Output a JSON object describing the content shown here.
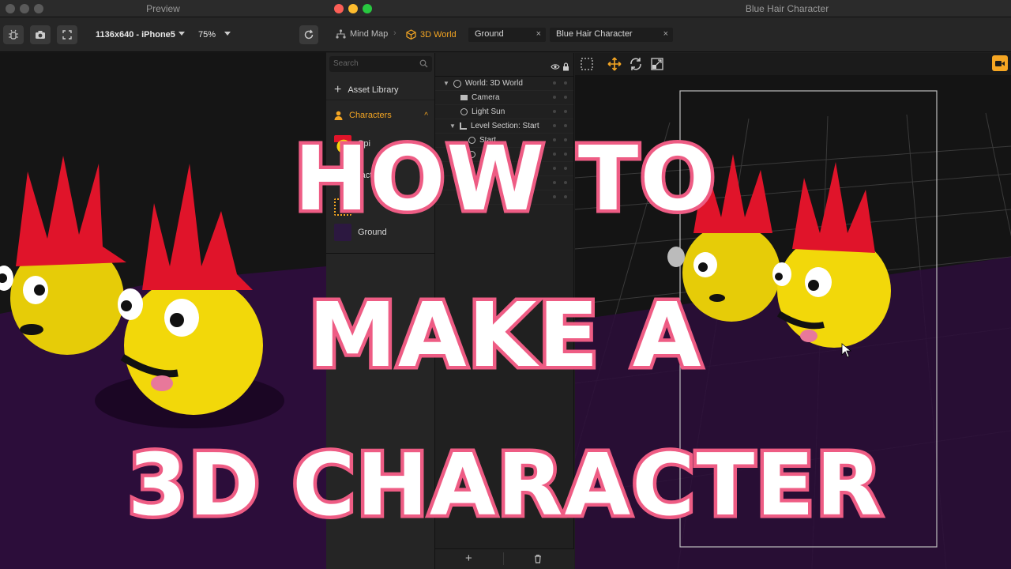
{
  "preview_window": {
    "title": "Preview",
    "toolbar": {
      "resolution": "1136x640 - iPhone5",
      "zoom": "75%"
    }
  },
  "editor_window": {
    "title": "Blue Hair Character",
    "breadcrumb": [
      {
        "label": "Mind Map"
      },
      {
        "label": "3D World"
      }
    ],
    "tabs": [
      {
        "label": "Ground"
      },
      {
        "label": "Blue Hair Character"
      }
    ],
    "left_panel": {
      "search_placeholder": "Search",
      "asset_library": "Asset Library",
      "characters_section": "Characters",
      "items": [
        {
          "label": "Spi"
        },
        {
          "label": "racter"
        },
        {
          "label": "Ground"
        }
      ]
    },
    "scene_tree": [
      {
        "label": "World: 3D World"
      },
      {
        "label": "Camera"
      },
      {
        "label": "Light Sun"
      },
      {
        "label": "Level Section: Start"
      },
      {
        "label": "Start"
      }
    ]
  },
  "overlay": {
    "line1": "HOW TO",
    "line2": "MAKE A",
    "line3": "3D CHARACTER"
  },
  "colors": {
    "accent": "#f5a623",
    "title_outline": "#ee5c84",
    "hair_red": "#e0142a",
    "face_yellow": "#f2d80a",
    "floor_purple": "#2c0d3a"
  }
}
